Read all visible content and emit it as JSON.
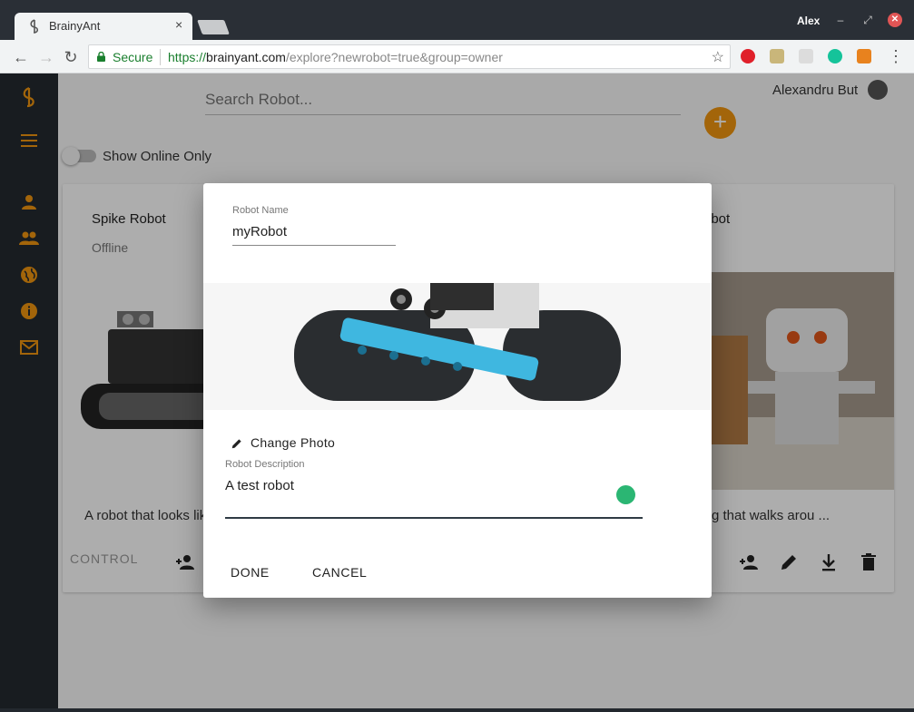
{
  "browser": {
    "tab_title": "BrainyAnt",
    "tab_close": "×",
    "user_name": "Alex",
    "secure_label": "Secure",
    "url_scheme": "https://",
    "url_host": "brainyant.com",
    "url_path": "/explore?newrobot=true&group=owner"
  },
  "header": {
    "search_placeholder": "Search Robot...",
    "account_name": "Alexandru But",
    "add_symbol": "+",
    "show_online_label": "Show Online Only"
  },
  "cards": [
    {
      "title": "Spike Robot",
      "status": "Offline",
      "description": "A robot that looks lik",
      "control_label": "CONTROL"
    },
    {
      "title": "obot",
      "description": "g that walks arou ..."
    }
  ],
  "dialog": {
    "name_label": "Robot Name",
    "name_value": "myRobot",
    "change_photo_label": "Change Photo",
    "description_label": "Robot Description",
    "description_value": "A test robot",
    "done_label": "DONE",
    "cancel_label": "CANCEL"
  },
  "colors": {
    "accent": "#f0960f",
    "sidebar_bg": "#242a30",
    "spinner": "#2bb673",
    "secure_green": "#1a7f2e"
  }
}
